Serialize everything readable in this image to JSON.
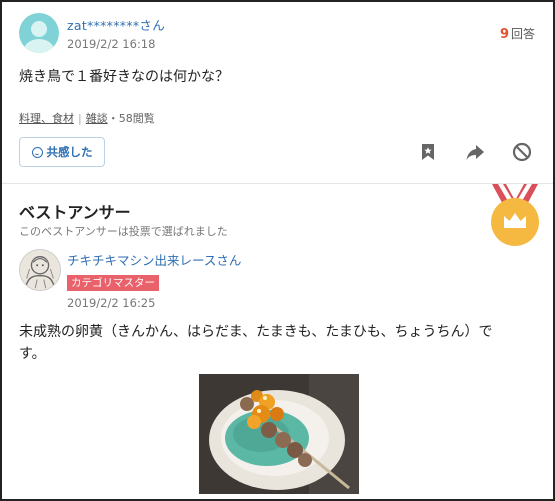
{
  "question": {
    "username": "zat********さん",
    "date": "2019/2/2 16:18",
    "answer_count": "9",
    "answer_label": "回答",
    "text": "焼き鳥で１番好きなのは何かな？",
    "tags": [
      "料理、食材",
      "雑談"
    ],
    "views": "・58閲覧",
    "empathy_label": "共感した"
  },
  "best_answer": {
    "title": "ベストアンサー",
    "subtitle": "このベストアンサーは投票で選ばれました",
    "username": "チキチキマシン出来レースさん",
    "badge": "カテゴリマスター",
    "date": "2019/2/2 16:25",
    "text": "未成熟の卵黄（きんかん、はらだま、たまきも、たまひも、ちょうちん）です。"
  },
  "icons": {
    "bookmark": "bookmark-icon",
    "share": "share-icon",
    "block": "block-icon",
    "medal": "crown-medal-icon"
  },
  "colors": {
    "link": "#2f6fb3",
    "answer_count": "#e0532d",
    "badge": "#e8616b",
    "medal": "#f5b942"
  }
}
